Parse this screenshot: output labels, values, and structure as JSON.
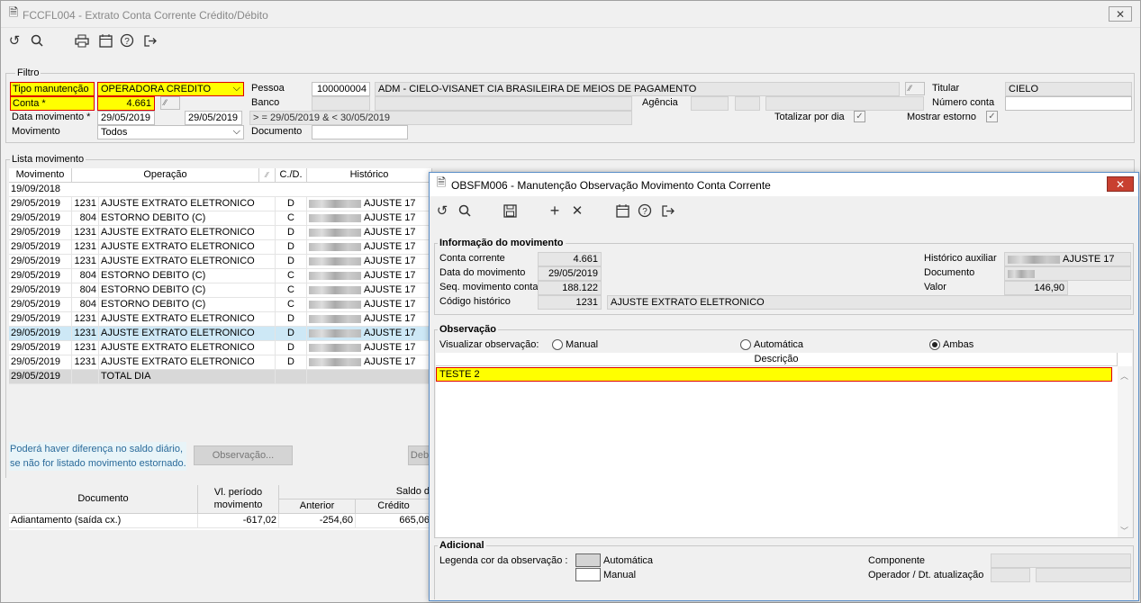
{
  "window": {
    "title": "FCCFL004 - Extrato Conta Corrente Crédito/Débito",
    "close": "✕"
  },
  "toolbar": {
    "icons": [
      "refresh-icon",
      "search-icon",
      "print-icon",
      "calendar-icon",
      "help-icon",
      "exit-icon"
    ]
  },
  "filtro": {
    "group": "Filtro",
    "tipo_label": "Tipo manutenção",
    "tipo_value": "OPERADORA CREDITO",
    "conta_label": "Conta *",
    "conta_value": "4.661",
    "data_label": "Data movimento *",
    "data_from": "29/05/2019",
    "data_to": "29/05/2019",
    "data_expr": "> = 29/05/2019  &  < 30/05/2019",
    "movimento_label": "Movimento",
    "movimento_value": "Todos",
    "pessoa_label": "Pessoa",
    "pessoa_code": "100000004",
    "pessoa_name": "ADM - CIELO-VISANET CIA BRASILEIRA DE MEIOS DE PAGAMENTO",
    "banco_label": "Banco",
    "agencia_label": "Agência",
    "documento_label": "Documento",
    "titular_label": "Titular",
    "titular_value": "CIELO",
    "numero_conta_label": "Número conta",
    "totalizar_label": "Totalizar por dia",
    "estorno_label": "Mostrar estorno"
  },
  "lista": {
    "group": "Lista movimento",
    "headers": {
      "movimento": "Movimento",
      "operacao": "Operação",
      "cd": "C./D.",
      "historico": "Histórico"
    },
    "first_row": "19/09/2018",
    "rows": [
      {
        "date": "29/05/2019",
        "code": "1231",
        "op": "AJUSTE EXTRATO ELETRONICO",
        "cd": "D",
        "hist": "AJUSTE 17"
      },
      {
        "date": "29/05/2019",
        "code": "804",
        "op": "ESTORNO DEBITO (C)",
        "cd": "C",
        "hist": "AJUSTE 17"
      },
      {
        "date": "29/05/2019",
        "code": "1231",
        "op": "AJUSTE EXTRATO ELETRONICO",
        "cd": "D",
        "hist": "AJUSTE 17"
      },
      {
        "date": "29/05/2019",
        "code": "1231",
        "op": "AJUSTE EXTRATO ELETRONICO",
        "cd": "D",
        "hist": "AJUSTE 17"
      },
      {
        "date": "29/05/2019",
        "code": "1231",
        "op": "AJUSTE EXTRATO ELETRONICO",
        "cd": "D",
        "hist": "AJUSTE 17"
      },
      {
        "date": "29/05/2019",
        "code": "804",
        "op": "ESTORNO DEBITO (C)",
        "cd": "C",
        "hist": "AJUSTE 17"
      },
      {
        "date": "29/05/2019",
        "code": "804",
        "op": "ESTORNO DEBITO (C)",
        "cd": "C",
        "hist": "AJUSTE 17"
      },
      {
        "date": "29/05/2019",
        "code": "804",
        "op": "ESTORNO DEBITO (C)",
        "cd": "C",
        "hist": "AJUSTE 17"
      },
      {
        "date": "29/05/2019",
        "code": "1231",
        "op": "AJUSTE EXTRATO ELETRONICO",
        "cd": "D",
        "hist": "AJUSTE 17"
      },
      {
        "date": "29/05/2019",
        "code": "1231",
        "op": "AJUSTE EXTRATO ELETRONICO",
        "cd": "D",
        "hist": "AJUSTE 17"
      },
      {
        "date": "29/05/2019",
        "code": "1231",
        "op": "AJUSTE EXTRATO ELETRONICO",
        "cd": "D",
        "hist": "AJUSTE 17"
      },
      {
        "date": "29/05/2019",
        "code": "1231",
        "op": "AJUSTE EXTRATO ELETRONICO",
        "cd": "D",
        "hist": "AJUSTE 17"
      }
    ],
    "total_date": "29/05/2019",
    "total_label": "TOTAL DIA",
    "note_line1": "Poderá haver diferença no saldo diário,",
    "note_line2": "se não for listado movimento estornado.",
    "obs_button": "Observação...",
    "deb_button": "Deb"
  },
  "saldo": {
    "documento": "Documento",
    "vl_periodo": "Vl. período",
    "movimento": "movimento",
    "saldo": "Saldo d",
    "anterior": "Anterior",
    "credito": "Crédito",
    "row_doc": "Adiantamento (saída cx.)",
    "row_vl": "-617,02",
    "row_ant": "-254,60",
    "row_cred": "665,06"
  },
  "dialog": {
    "title": "OBSFM006 - Manutenção Observação Movimento Conta Corrente",
    "info_group": "Informação do movimento",
    "conta_label": "Conta corrente",
    "conta_value": "4.661",
    "data_label": "Data do movimento",
    "data_value": "29/05/2019",
    "seq_label": "Seq. movimento conta",
    "seq_value": "188.122",
    "codigo_label": "Código histórico",
    "codigo_value": "1231",
    "codigo_desc": "AJUSTE EXTRATO ELETRONICO",
    "hist_aux_label": "Histórico auxiliar",
    "hist_aux_value": "AJUSTE 17",
    "documento_label": "Documento",
    "valor_label": "Valor",
    "valor_value": "146,90",
    "obs_group": "Observação",
    "visualizar_label": "Visualizar observação:",
    "radio_manual": "Manual",
    "radio_auto": "Automática",
    "radio_ambas": "Ambas",
    "descricao_header": "Descrição",
    "obs_row": "TESTE 2",
    "adicional_group": "Adicional",
    "legenda_label": "Legenda cor da observação :",
    "legenda_auto": "Automática",
    "legenda_manual": "Manual",
    "componente_label": "Componente",
    "operador_label": "Operador / Dt. atualização"
  }
}
